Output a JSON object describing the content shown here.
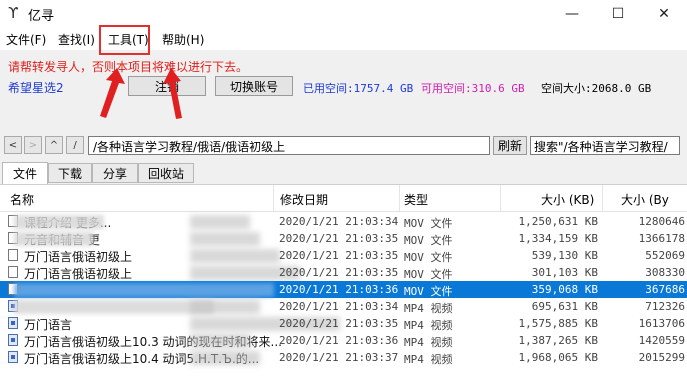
{
  "window": {
    "icon": "logo-icon",
    "title": "亿寻"
  },
  "menu": {
    "file": "文件(F)",
    "find": "查找(I)",
    "tools": "工具(T)",
    "help": "帮助(H)"
  },
  "notice": "请帮转发寻人，否则本项目将难以进行下去。",
  "account": {
    "name": "希望星选2",
    "logout_label": "注销",
    "switch_label": "切换账号",
    "used_label": "已用空间:1757.4 GB",
    "available_label": "可用空间:310.6 GB",
    "total_label": "空间大小:2068.0 GB"
  },
  "colors": {
    "accent": "#1d3ad6",
    "notice": "#e0201a",
    "available": "#d01fb0",
    "selection": "#0a78d7",
    "highlight_box": "#e03030"
  },
  "nav": {
    "back": "<",
    "forward": ">",
    "up": "^",
    "root": "/",
    "path": "/各种语言学习教程/俄语/俄语初级上",
    "refresh_label": "刷新",
    "search_value": "搜索\"/各种语言学习教程/"
  },
  "tabs": [
    "文件",
    "下载",
    "分享",
    "回收站"
  ],
  "table": {
    "headers": {
      "name": "名称",
      "date": "修改日期",
      "type": "类型",
      "size_kb": "大小 (KB)",
      "size_b": "大小 (By"
    },
    "rows": [
      {
        "name": "课程介绍  更多...",
        "date": "2020/1/21 21:03:34",
        "type": "MOV 文件",
        "size_kb": "1,250,631 KB",
        "size_b": "1280646",
        "icon": "mov-file-icon"
      },
      {
        "name": "元音和辅音  更",
        "date": "2020/1/21 21:03:35",
        "type": "MOV 文件",
        "size_kb": "1,334,159 KB",
        "size_b": "1366178",
        "icon": "mov-file-icon"
      },
      {
        "name": "万门语言俄语初级上",
        "date": "2020/1/21 21:03:35",
        "type": "MOV 文件",
        "size_kb": "539,130 KB",
        "size_b": "552069",
        "icon": "mov-file-icon"
      },
      {
        "name": "万门语言俄语初级上",
        "date": "2020/1/21 21:03:35",
        "type": "MOV 文件",
        "size_kb": "301,103 KB",
        "size_b": "308330",
        "icon": "mov-file-icon"
      },
      {
        "name": "",
        "date": "2020/1/21 21:03:36",
        "type": "MOV 文件",
        "size_kb": "359,068 KB",
        "size_b": "367686",
        "icon": "mov-file-icon",
        "selected": true
      },
      {
        "name": "",
        "date": "2020/1/21 21:03:34",
        "type": "MP4 视频",
        "size_kb": "695,631 KB",
        "size_b": "712326",
        "icon": "mp4-file-icon"
      },
      {
        "name": "万门语言",
        "date": "2020/1/21 21:03:35",
        "type": "MP4 视频",
        "size_kb": "1,575,885 KB",
        "size_b": "1613706",
        "icon": "mp4-file-icon"
      },
      {
        "name": "万门语言俄语初级上10.3 动词的现在时和将来...",
        "date": "2020/1/21 21:03:36",
        "type": "MP4 视频",
        "size_kb": "1,387,265 KB",
        "size_b": "1420559",
        "icon": "mp4-file-icon"
      },
      {
        "name": "万门语言俄语初级上10.4 动词5.Н.Т.Ъ.的...",
        "date": "2020/1/21 21:03:37",
        "type": "MP4 视频",
        "size_kb": "1,968,065 KB",
        "size_b": "2015299",
        "icon": "mp4-file-icon"
      }
    ]
  }
}
